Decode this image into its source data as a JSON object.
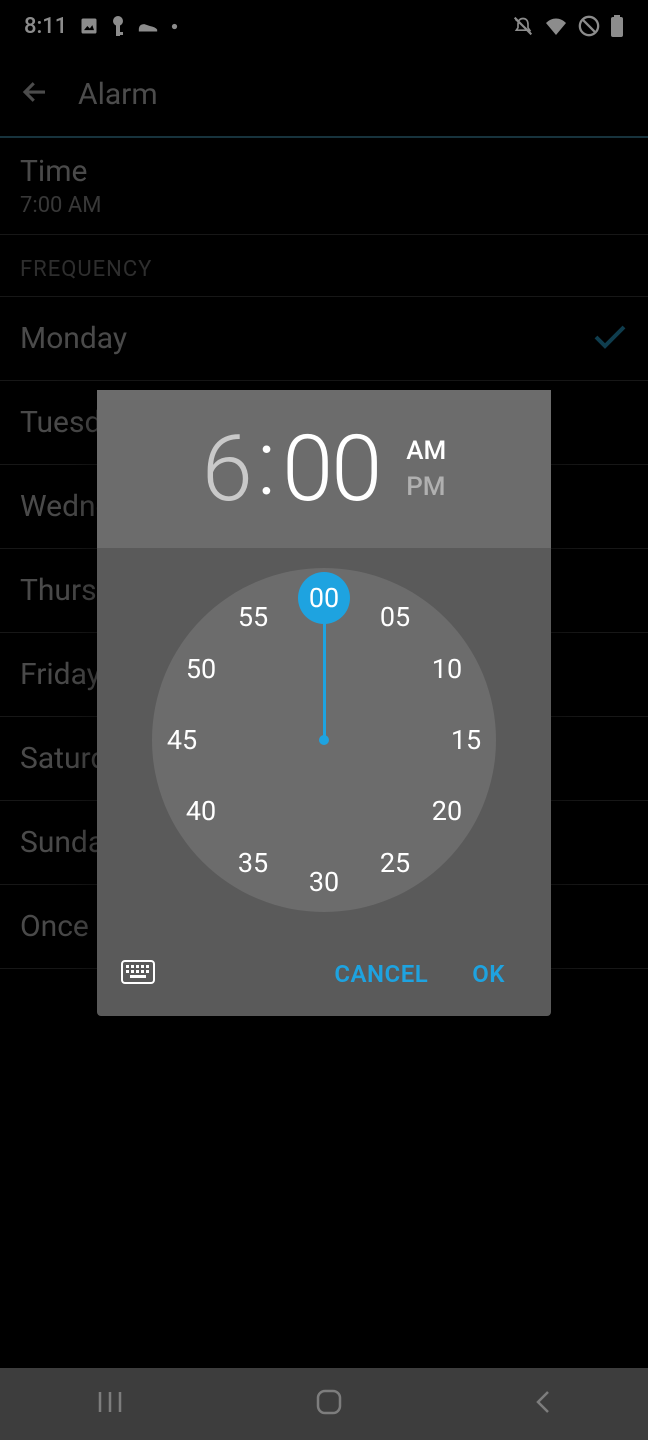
{
  "status": {
    "time": "8:11"
  },
  "appbar": {
    "title": "Alarm"
  },
  "time_row": {
    "label": "Time",
    "value": "7:00 AM"
  },
  "section": {
    "frequency": "FREQUENCY"
  },
  "days": [
    {
      "label": "Monday",
      "checked": true
    },
    {
      "label": "Tuesday",
      "checked": false
    },
    {
      "label": "Wednesday",
      "checked": false
    },
    {
      "label": "Thursday",
      "checked": false
    },
    {
      "label": "Friday",
      "checked": false
    },
    {
      "label": "Saturday",
      "checked": false
    },
    {
      "label": "Sunday",
      "checked": false
    },
    {
      "label": "Once",
      "checked": false
    }
  ],
  "picker": {
    "hour": "6",
    "minute": "00",
    "am": "AM",
    "pm": "PM",
    "am_active": true,
    "selected_minute": 0,
    "ticks": [
      "00",
      "05",
      "10",
      "15",
      "20",
      "25",
      "30",
      "35",
      "40",
      "45",
      "50",
      "55"
    ],
    "cancel": "CANCEL",
    "ok": "OK"
  }
}
